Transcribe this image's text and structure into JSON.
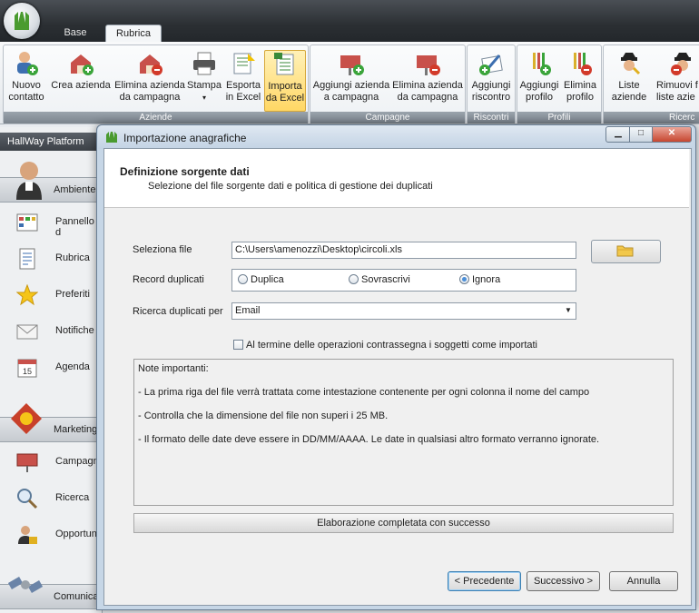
{
  "app": {
    "tabs": [
      {
        "label": "Base"
      },
      {
        "label": "Rubrica"
      }
    ],
    "ribbon": {
      "groups": [
        {
          "label": "Aziende",
          "buttons": [
            {
              "label": "Nuovo\ncontatto",
              "icon": "add-contact-icon"
            },
            {
              "label": "Crea azienda",
              "icon": "add-company-icon"
            },
            {
              "label": "Elimina azienda\nda campagna",
              "icon": "remove-company-icon"
            },
            {
              "label": "Stampa",
              "icon": "printer-icon"
            },
            {
              "label": "Esporta\nin Excel",
              "icon": "export-excel-icon"
            },
            {
              "label": "Importa\nda Excel",
              "icon": "import-excel-icon"
            }
          ]
        },
        {
          "label": "Campagne",
          "buttons": [
            {
              "label": "Aggiungi azienda\na campagna",
              "icon": "add-to-campaign-icon"
            },
            {
              "label": "Elimina azienda\nda campagna",
              "icon": "remove-from-campaign-icon"
            }
          ]
        },
        {
          "label": "Riscontri",
          "buttons": [
            {
              "label": "Aggiungi\nriscontro",
              "icon": "add-feedback-icon"
            }
          ]
        },
        {
          "label": "Profili",
          "buttons": [
            {
              "label": "Aggiungi\nprofilo",
              "icon": "add-profile-icon"
            },
            {
              "label": "Elimina\nprofilo",
              "icon": "remove-profile-icon"
            }
          ]
        },
        {
          "label": "Ricerc",
          "buttons": [
            {
              "label": "Liste\naziende",
              "icon": "company-lists-icon"
            },
            {
              "label": "Rimuovi f\nliste azie",
              "icon": "remove-from-lists-icon"
            }
          ]
        }
      ]
    },
    "sidebar": {
      "title": "HallWay Platform",
      "sections": [
        {
          "label": "Ambiente"
        },
        {
          "label": "Marketing"
        },
        {
          "label": "Comunica"
        }
      ],
      "items": [
        {
          "label": "Pannello d"
        },
        {
          "label": "Rubrica"
        },
        {
          "label": "Preferiti"
        },
        {
          "label": "Notifiche"
        },
        {
          "label": "Agenda"
        },
        {
          "label": "Campagne"
        },
        {
          "label": "Ricerca"
        },
        {
          "label": "Opportun"
        }
      ]
    }
  },
  "dialog": {
    "title": "Importazione anagrafiche",
    "step_title": "Definizione sorgente dati",
    "step_subtitle": "Selezione del file sorgente dati e politica di gestione dei duplicati",
    "file_label": "Seleziona file",
    "file_value": "C:\\Users\\amenozzi\\Desktop\\circoli.xls",
    "duplicates_label": "Record duplicati",
    "duplicate_options": [
      "Duplica",
      "Sovrascrivi",
      "Ignora"
    ],
    "duplicate_selected": "Ignora",
    "search_label": "Ricerca duplicati per",
    "search_value": "Email",
    "checkbox_label": "Al termine delle operazioni contrassegna i soggetti come importati",
    "checkbox_checked": false,
    "notes": [
      "Note importanti:",
      "- La prima riga del file verrà trattata come intestazione contenente per ogni colonna il nome del campo",
      "- Controlla che la dimensione del file non superi i 25 MB.",
      "- Il formato delle date deve essere in DD/MM/AAAA. Le date in qualsiasi altro formato verranno ignorate."
    ],
    "status": "Elaborazione completata con successo",
    "buttons": {
      "prev": "< Precedente",
      "next": "Successivo >",
      "cancel": "Annulla"
    }
  },
  "colors": {
    "accent": "#ffd765",
    "titlebar": "#2b2f33",
    "selected_radio": "#4b8fd8"
  }
}
